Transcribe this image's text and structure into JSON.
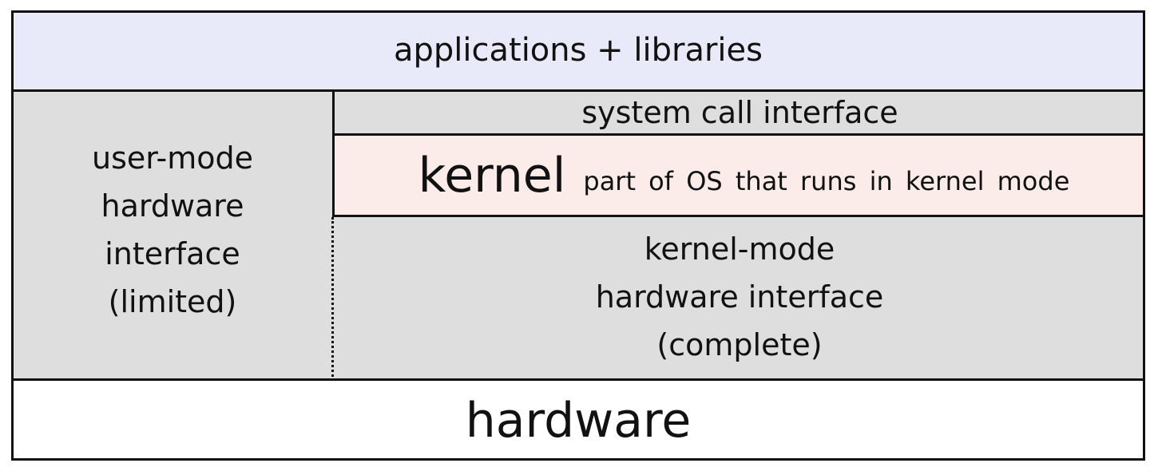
{
  "layers": {
    "applications": "applications + libraries",
    "user_mode_interface": {
      "lines": [
        "user-mode",
        "hardware",
        "interface",
        "(limited)"
      ]
    },
    "system_call_interface": "system call interface",
    "kernel": {
      "title": "kernel",
      "description": "part of OS that runs in kernel mode"
    },
    "kernel_mode_interface": {
      "lines": [
        "kernel-mode",
        "hardware interface",
        "(complete)"
      ]
    },
    "hardware": "hardware"
  },
  "colors": {
    "applications_fill": "#e8eaf9",
    "interface_fill": "#dedede",
    "kernel_fill": "#fbecea",
    "hardware_fill": "#ffffff",
    "border": "#111111"
  }
}
